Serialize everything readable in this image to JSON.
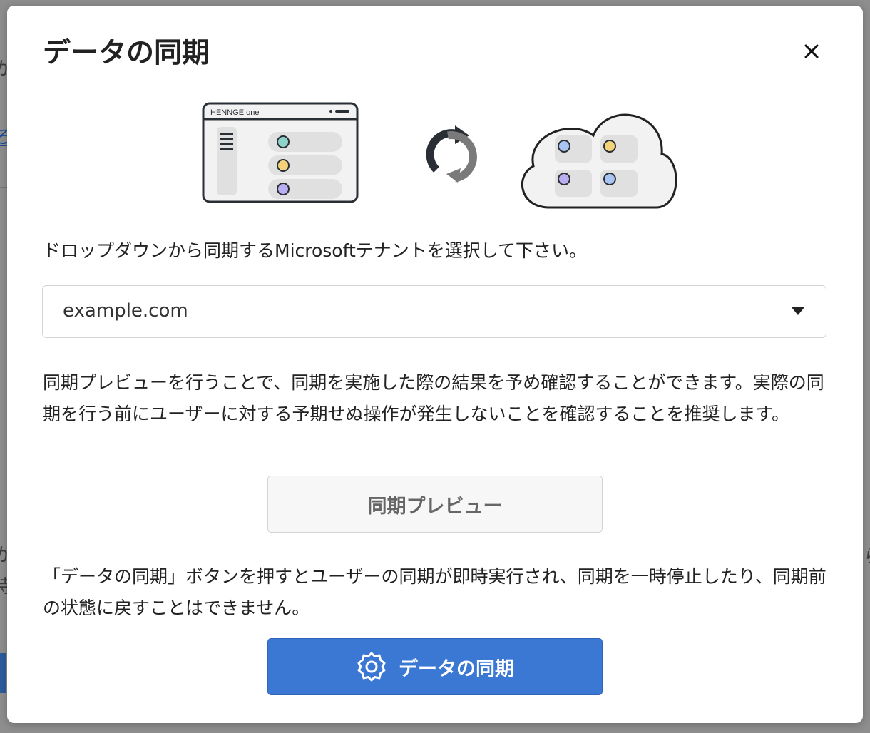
{
  "modal": {
    "title": "データの同期",
    "close_label": "×",
    "illustration": {
      "app_brand": "HENNGE one"
    },
    "instruction": "ドロップダウンから同期するMicrosoftテナントを選択して下さい。",
    "tenant_select": {
      "selected_value": "example.com"
    },
    "preview_description": "同期プレビューを行うことで、同期を実施した際の結果を予め確認することができます。実際の同期を行う前にユーザーに対する予期せぬ操作が発生しないことを確認することを推奨します。",
    "preview_button_label": "同期プレビュー",
    "warning_text": "「データの同期」ボタンを押すとユーザーの同期が即時実行され、同期を一時停止したり、同期前の状態に戻すことはできません。",
    "sync_button_label": "データの同期"
  },
  "colors": {
    "primary_button": "#3a78d4",
    "overlay": "#8e8e8e",
    "dot_teal": "#8ed2c9",
    "dot_yellow": "#f3d27a",
    "dot_purple": "#b9aef0",
    "dot_blue": "#a9c4f2"
  },
  "icons": {
    "close": "close-icon",
    "sync": "sync-arrows-icon",
    "gear": "gear-icon"
  }
}
